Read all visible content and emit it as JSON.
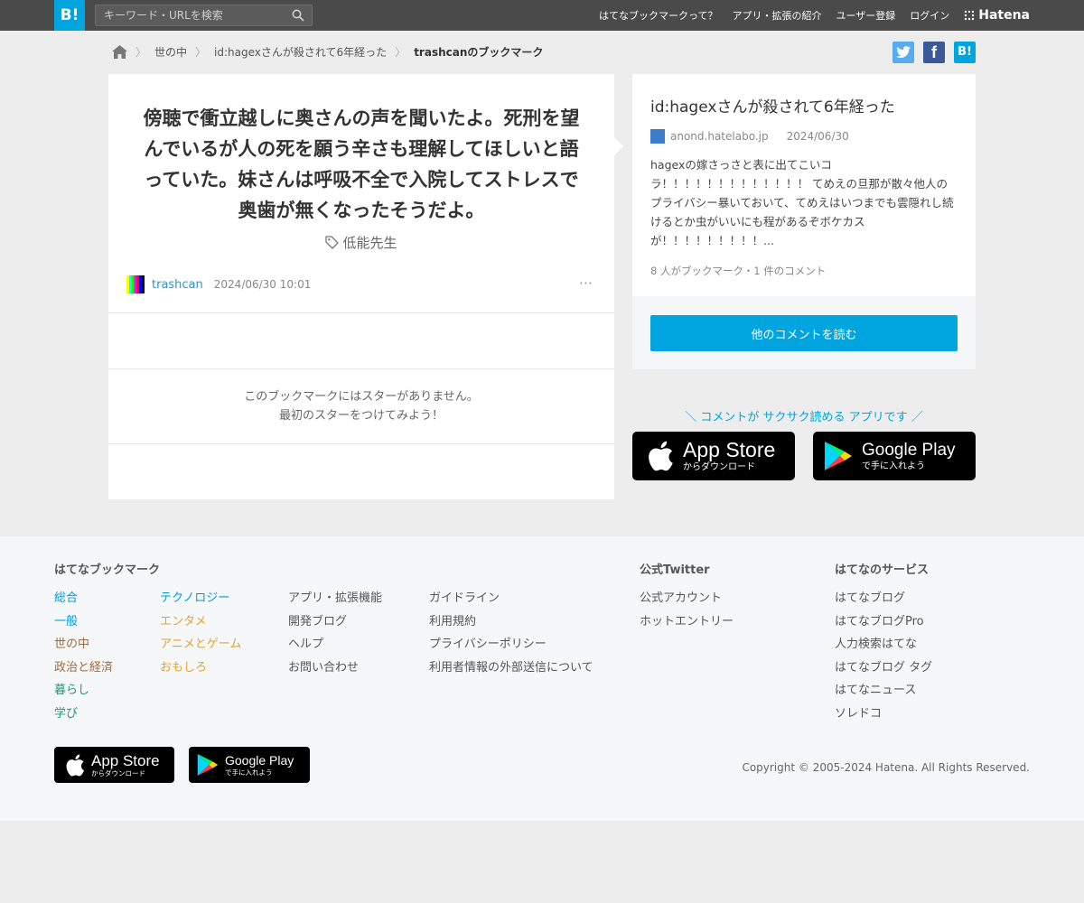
{
  "header": {
    "logo": "B!",
    "search_placeholder": "キーワード・URLを検索",
    "nav": [
      "はてなブックマークって？",
      "アプリ・拡張の紹介",
      "ユーザー登録",
      "ログイン"
    ],
    "brand": "Hatena"
  },
  "breadcrumb": {
    "items": [
      "世の中",
      "id:hagexさんが殺されて6年経った",
      "trashcanのブックマーク"
    ]
  },
  "share": {
    "twitter": "t",
    "facebook": "f",
    "hatena": "B!"
  },
  "bookmark": {
    "comment": "傍聴で衝立越しに奥さんの声を聞いたよ。死刑を望んでいるが人の死を願う辛さも理解してほしいと語っていた。妹さんは呼吸不全で入院してストレスで奥歯が無くなったそうだよ。",
    "tag": "低能先生",
    "username": "trashcan",
    "datetime": "2024/06/30 10:01",
    "more": "···",
    "nostar_line1": "このブックマークにはスターがありません。",
    "nostar_line2": "最初のスターをつけてみよう！"
  },
  "entry": {
    "title": "id:hagexさんが殺されて6年経った",
    "domain": "anond.hatelabo.jp",
    "date": "2024/06/30",
    "description": "hagexの嫁さっさと表に出てこいコラ！！！！！！！！！！！！！ てめえの旦那が散々他人のプライバシー暴いておいて、てめえはいつまでも雲隠れし続けるとか虫がいいにも程があるぞボケカスが！！！！！！！！！...",
    "count": "8 人がブックマーク・1 件のコメント",
    "button": "他のコメントを読む"
  },
  "promo": {
    "text": "＼ コメントが サクサク読める アプリです ／",
    "appstore_big": "App Store",
    "appstore_small": "からダウンロード",
    "googleplay_big": "Google Play",
    "googleplay_small": "で手に入れよう"
  },
  "footer": {
    "col1_title": "はてなブックマーク",
    "categories_a": [
      "総合",
      "一般",
      "世の中",
      "政治と経済",
      "暮らし",
      "学び"
    ],
    "categories_a_colors": [
      "#009ad6",
      "#009ad6",
      "#a06a3c",
      "#a06a3c",
      "#26937c",
      "#26937c"
    ],
    "categories_b": [
      "テクノロジー",
      "エンタメ",
      "アニメとゲーム",
      "おもしろ"
    ],
    "categories_b_colors": [
      "#009ad6",
      "#e3a52b",
      "#e3a52b",
      "#e3a52b"
    ],
    "links_c": [
      "アプリ・拡張機能",
      "開発ブログ",
      "ヘルプ",
      "お問い合わせ"
    ],
    "links_d": [
      "ガイドライン",
      "利用規約",
      "プライバシーポリシー",
      "利用者情報の外部送信について"
    ],
    "col2_title": "公式Twitter",
    "twitter_links": [
      "公式アカウント",
      "ホットエントリー"
    ],
    "col3_title": "はてなのサービス",
    "services": [
      "はてなブログ",
      "はてなブログPro",
      "人力検索はてな",
      "はてなブログ タグ",
      "はてなニュース",
      "ソレドコ"
    ],
    "copyright": "Copyright © 2005-2024 Hatena. All Rights Reserved."
  },
  "colors": {
    "accent": "#00a4de",
    "header": "#4a4a4a",
    "twitter": "#55acee",
    "facebook": "#3b5998"
  }
}
